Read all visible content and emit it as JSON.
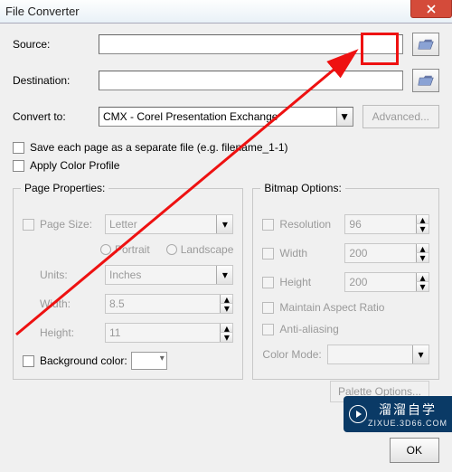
{
  "title": "File Converter",
  "labels": {
    "source": "Source:",
    "destination": "Destination:",
    "convert_to": "Convert to:",
    "advanced": "Advanced...",
    "save_each": "Save each page as a separate file (e.g. filename_1-1)",
    "apply_profile": "Apply Color Profile",
    "page_props": "Page Properties:",
    "bitmap_opts": "Bitmap Options:",
    "page_size": "Page Size:",
    "portrait": "Portrait",
    "landscape": "Landscape",
    "units": "Units:",
    "width": "Width:",
    "height": "Height:",
    "bgcolor": "Background color:",
    "resolution": "Resolution",
    "bwidth": "Width",
    "bheight": "Height",
    "aspect": "Maintain Aspect Ratio",
    "anti": "Anti-aliasing",
    "colormode": "Color Mode:",
    "palette": "Palette Options...",
    "ok": "OK"
  },
  "values": {
    "source": "",
    "destination": "",
    "convert_to": "CMX - Corel Presentation Exchange",
    "page_size": "Letter",
    "units": "Inches",
    "width": "8.5",
    "height": "11",
    "resolution": "96",
    "bwidth": "200",
    "bheight": "200",
    "colormode": ""
  },
  "watermark": {
    "line1": "溜溜自学",
    "line2": "ZIXUE.3D66.COM"
  }
}
